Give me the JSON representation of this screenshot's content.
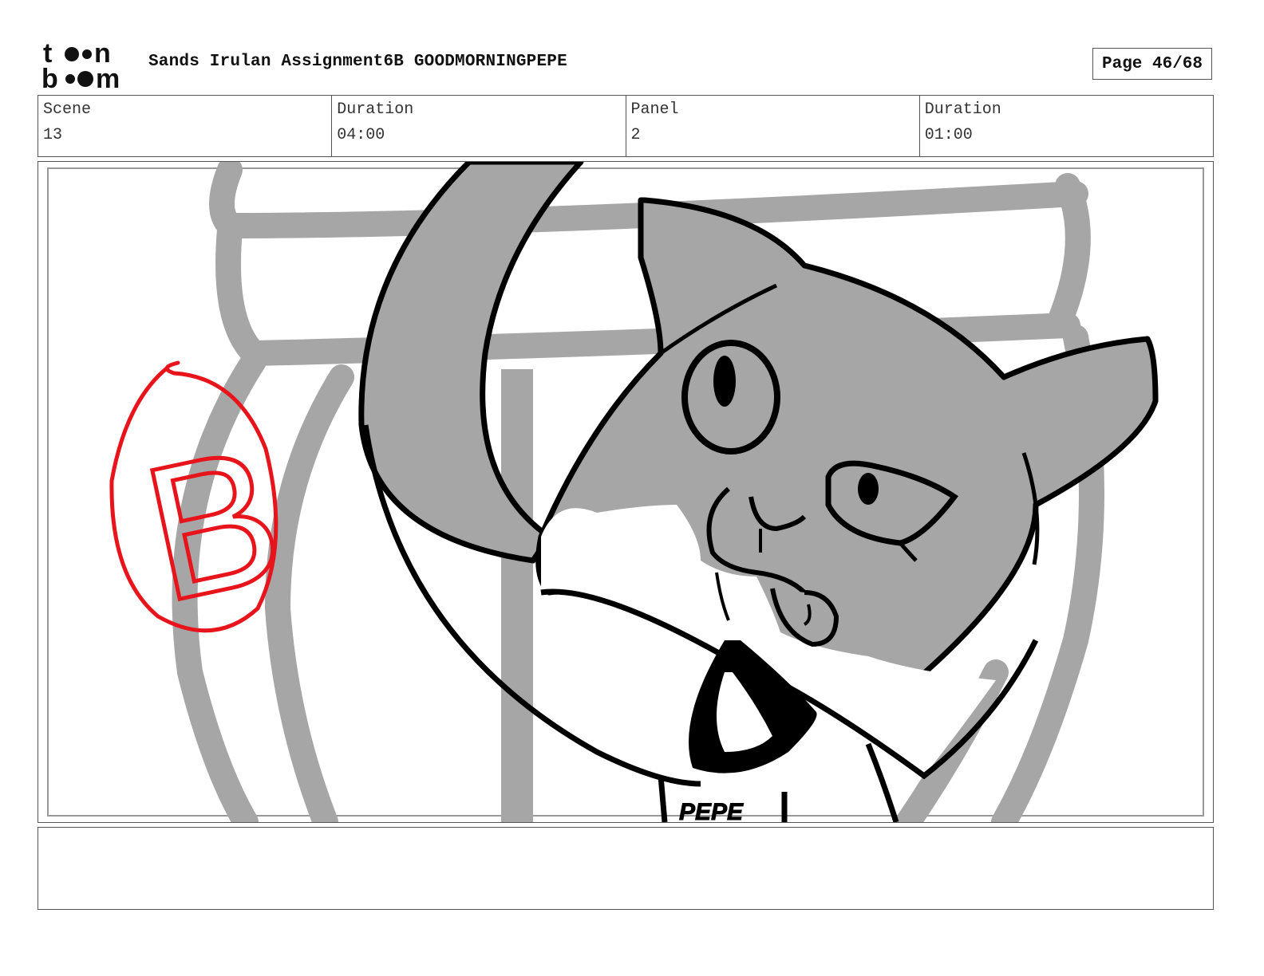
{
  "header": {
    "logo": {
      "line1": "toon",
      "line2": "boom"
    },
    "title": "Sands Irulan Assignment6B GOODMORNINGPEPE",
    "page_label": "Page 46/68"
  },
  "info": {
    "scene_label": "Scene",
    "scene_value": "13",
    "scene_duration_label": "Duration",
    "scene_duration_value": "04:00",
    "panel_label": "Panel",
    "panel_value": "2",
    "panel_duration_label": "Duration",
    "panel_duration_value": "01:00"
  },
  "panel": {
    "annotation_letter": "B",
    "shirt_text": "PEPE",
    "colors": {
      "annotation": "#e8141c",
      "gray_fill": "#a6a6a6",
      "line": "#000000"
    }
  },
  "notes": {
    "text": ""
  }
}
